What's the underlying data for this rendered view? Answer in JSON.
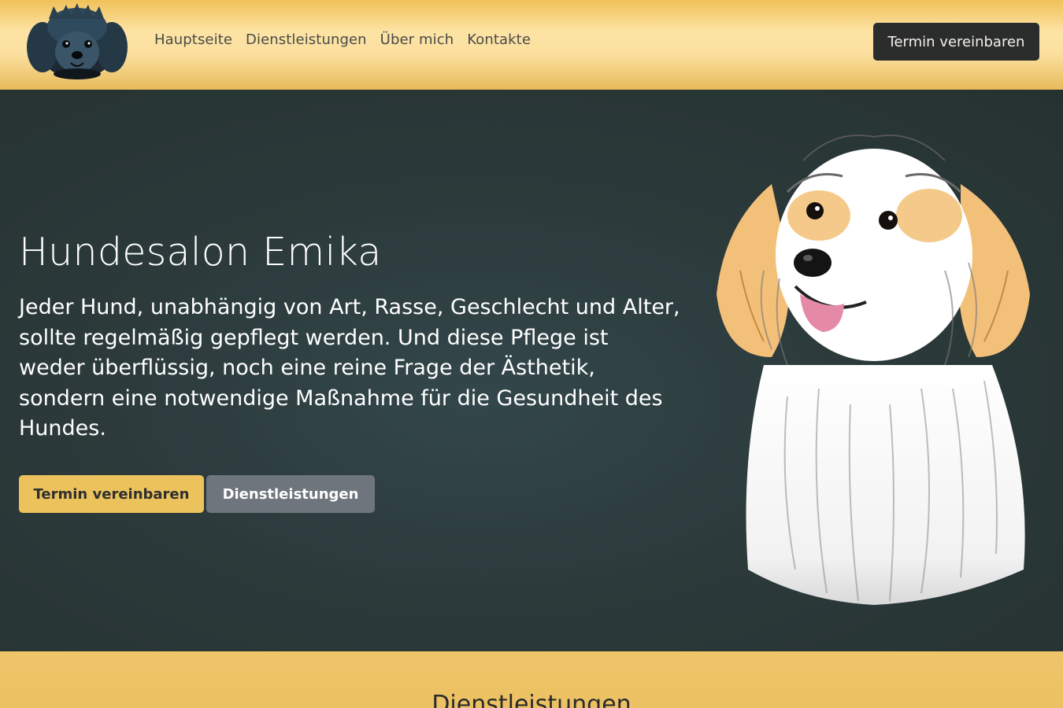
{
  "header": {
    "logo_icon": "dog-logo-icon",
    "nav": [
      {
        "label": "Hauptseite"
      },
      {
        "label": "Dienstleistungen"
      },
      {
        "label": "Über mich"
      },
      {
        "label": "Kontakte"
      }
    ],
    "cta_label": "Termin vereinbaren"
  },
  "hero": {
    "title": "Hundesalon Emika",
    "text": "Jeder Hund, unabhängig von Art, Rasse, Geschlecht und Alter, sollte regelmäßig gepflegt werden. Und diese Pflege ist weder überflüssig, noch eine reine Frage der Ästhetik, sondern eine notwendige Maßnahme für die Gesundheit des Hundes.",
    "primary_button": "Termin vereinbaren",
    "secondary_button": "Dienstleistungen",
    "image_icon": "dog-illustration"
  },
  "services": {
    "title": "Dienstleistungen"
  },
  "colors": {
    "header_gold": "#f0c15a",
    "hero_dark": "#2c3a3b",
    "button_dark": "#2a2d2b",
    "button_yellow": "#ebc25c",
    "button_gray": "#6e757c"
  }
}
